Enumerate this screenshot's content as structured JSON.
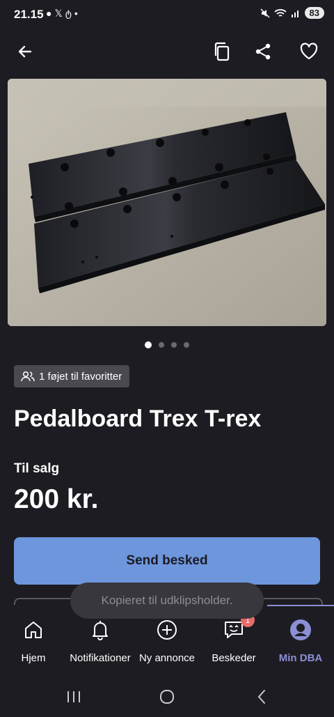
{
  "status_bar": {
    "time": "21.15",
    "left_icons": [
      "chat-bubble-icon",
      "x-logo-icon",
      "threads-icon",
      "dot-icon"
    ],
    "right_icons": [
      "mute-icon",
      "wifi-icon",
      "signal-icon"
    ],
    "battery": "83"
  },
  "top_bar": {
    "icons": [
      "back-arrow-icon",
      "copy-icon",
      "share-icon",
      "heart-icon"
    ]
  },
  "gallery": {
    "image_count": 4,
    "active_index": 0
  },
  "listing": {
    "favorites_text": "1 føjet til favoritter",
    "title": "Pedalboard Trex T-rex",
    "sale_type": "Til salg",
    "price": "200 kr."
  },
  "actions": {
    "send_message": "Send besked"
  },
  "toast": {
    "message": "Kopieret til udklipsholder."
  },
  "bottom_nav": {
    "items": [
      {
        "label": "Hjem",
        "icon": "home-icon"
      },
      {
        "label": "Notifikationer",
        "icon": "bell-icon"
      },
      {
        "label": "Ny annonce",
        "icon": "plus-circle-icon"
      },
      {
        "label": "Beskeder",
        "icon": "message-icon",
        "badge": "1"
      },
      {
        "label": "Min DBA",
        "icon": "profile-icon",
        "active": true
      }
    ]
  },
  "colors": {
    "background": "#1d1c22",
    "primary_button": "#6d96dc",
    "active_nav": "#8b8fd6",
    "badge": "#e86a6a"
  }
}
